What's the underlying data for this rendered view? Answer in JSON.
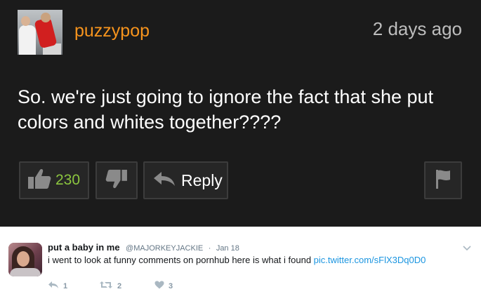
{
  "comment": {
    "username": "puzzypop",
    "time": "2 days ago",
    "text": "So. we're just going to ignore the fact that she put colors and whites together????",
    "like_count": "230",
    "reply_label": "Reply",
    "icons": {
      "like": "thumbs-up-icon",
      "dislike": "thumbs-down-icon",
      "reply": "reply-arrow-icon",
      "flag": "flag-icon"
    },
    "colors": {
      "username": "#f7941d",
      "like_count": "#8cc63f",
      "background": "#1b1b1b"
    }
  },
  "tweet": {
    "name": "put a baby in me",
    "handle": "@MAJORKEYJACKIE",
    "separator": "·",
    "date": "Jan 18",
    "text": "i went to look at funny comments on pornhub here is what i found ",
    "link": "pic.twitter.com/sFlX3Dq0D0",
    "reply_count": "1",
    "retweet_count": "2",
    "like_count": "3",
    "icons": {
      "reply": "reply-icon",
      "retweet": "retweet-icon",
      "like": "heart-icon",
      "more": "chevron-down-icon"
    },
    "colors": {
      "link": "#1b95e0",
      "meta": "#657786"
    }
  }
}
